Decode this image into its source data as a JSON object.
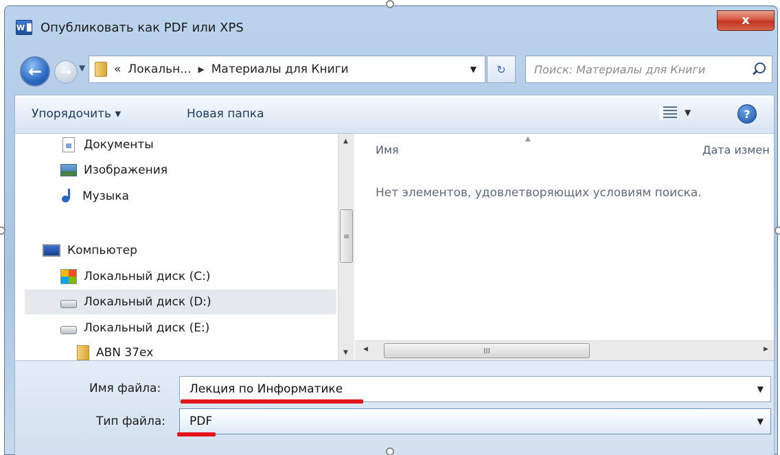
{
  "window": {
    "title": "Опубликовать как PDF или XPS",
    "app_icon": "W",
    "close_glyph": "x"
  },
  "nav": {
    "back_glyph": "←",
    "forward_glyph": "→",
    "breadcrumb_overflow": "«",
    "breadcrumbs": [
      "Локальн...",
      "Материалы для Книги"
    ],
    "breadcrumb_separator": "▶",
    "dropdown_glyph": "▼",
    "refresh_glyph": "↻",
    "search_placeholder": "Поиск: Материалы для Книги"
  },
  "toolbar": {
    "organize_label": "Упорядочить ▾",
    "new_folder_label": "Новая папка",
    "view_dropdown_glyph": "▼",
    "help_glyph": "?"
  },
  "tree": {
    "items": [
      {
        "label": "Документы",
        "icon": "documents-icon"
      },
      {
        "label": "Изображения",
        "icon": "pictures-icon"
      },
      {
        "label": "Музыка",
        "icon": "music-icon"
      },
      {
        "label": "Компьютер",
        "icon": "computer-icon"
      },
      {
        "label": "Локальный диск (C:)",
        "icon": "windows-drive-icon"
      },
      {
        "label": "Локальный диск (D:)",
        "icon": "hard-drive-icon",
        "selected": true
      },
      {
        "label": "Локальный диск (E:)",
        "icon": "hard-drive-icon"
      },
      {
        "label": "ABN 37ex",
        "icon": "folder-icon"
      }
    ]
  },
  "file_list": {
    "columns": [
      "Имя",
      "Дата измен"
    ],
    "empty_message": "Нет элементов, удовлетворяющих условиям поиска."
  },
  "scrollbars": {
    "grip_vertical": "≡",
    "grip_horizontal": "III",
    "up": "▲",
    "down": "▼",
    "left": "◀",
    "right": "▶"
  },
  "save_fields": {
    "filename_label": "Имя файла:",
    "filename_value": "Лекция по Информатике",
    "filetype_label": "Тип файла:",
    "filetype_value": "PDF",
    "dropdown_glyph": "▼"
  },
  "colors": {
    "annotation_red": "#e3151b",
    "close_button": "#c0351f",
    "selection_bg": "#e5e9ee"
  }
}
